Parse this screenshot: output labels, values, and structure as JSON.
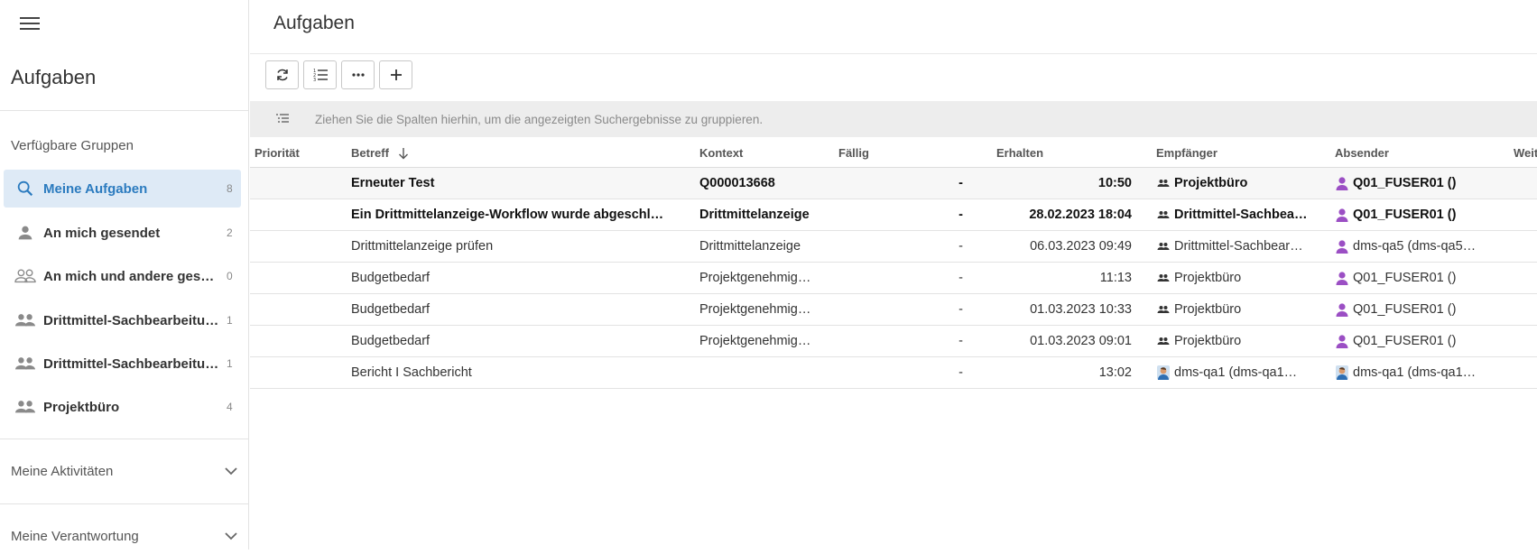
{
  "sidebar": {
    "title": "Aufgaben",
    "groups_heading": "Verfügbare Gruppen",
    "items": [
      {
        "label": "Meine Aufgaben",
        "count": "8",
        "icon": "search-icon"
      },
      {
        "label": "An mich gesendet",
        "count": "2",
        "icon": "person-icon"
      },
      {
        "label": "An mich und andere gese…",
        "count": "0",
        "icon": "people-outline-icon"
      },
      {
        "label": "Drittmittel-Sachbearbeitu…",
        "count": "1",
        "icon": "group-icon"
      },
      {
        "label": "Drittmittel-Sachbearbeitu…",
        "count": "1",
        "icon": "group-icon"
      },
      {
        "label": "Projektbüro",
        "count": "4",
        "icon": "group-icon"
      }
    ],
    "sections": [
      {
        "label": "Meine Aktivitäten"
      },
      {
        "label": "Meine Verantwortung"
      }
    ]
  },
  "main": {
    "title": "Aufgaben",
    "group_hint": "Ziehen Sie die Spalten hierhin, um die angezeigten Suchergebnisse zu gruppieren."
  },
  "table": {
    "columns": {
      "prioritaet": "Priorität",
      "betreff": "Betreff",
      "kontext": "Kontext",
      "faellig": "Fällig",
      "erhalten": "Erhalten",
      "empfaenger": "Empfänger",
      "absender": "Absender",
      "weitere": "Weit"
    },
    "rows": [
      {
        "betreff": "Erneuter Test",
        "kontext": "Q000013668",
        "faellig": "-",
        "erhalten": "10:50",
        "empfaenger": "Projektbüro",
        "absender": "Q01_FUSER01 ()",
        "bold": true
      },
      {
        "betreff": "Ein Drittmittelanzeige-Workflow wurde abgeschlo…",
        "kontext": "Drittmittelanzeige",
        "faellig": "-",
        "erhalten": "28.02.2023 18:04",
        "empfaenger": "Drittmittel-Sachbea…",
        "absender": "Q01_FUSER01 ()",
        "bold": true
      },
      {
        "betreff": "Drittmittelanzeige prüfen",
        "kontext": "Drittmittelanzeige",
        "faellig": "-",
        "erhalten": "06.03.2023 09:49",
        "empfaenger": "Drittmittel-Sachbear…",
        "absender": "dms-qa5 (dms-qa5…",
        "bold": false
      },
      {
        "betreff": "Budgetbedarf",
        "kontext": "Projektgenehmig…",
        "faellig": "-",
        "erhalten": "11:13",
        "empfaenger": "Projektbüro",
        "absender": "Q01_FUSER01 ()",
        "bold": false
      },
      {
        "betreff": "Budgetbedarf",
        "kontext": "Projektgenehmig…",
        "faellig": "-",
        "erhalten": "01.03.2023 10:33",
        "empfaenger": "Projektbüro",
        "absender": "Q01_FUSER01 ()",
        "bold": false
      },
      {
        "betreff": "Budgetbedarf",
        "kontext": "Projektgenehmig…",
        "faellig": "-",
        "erhalten": "01.03.2023 09:01",
        "empfaenger": "Projektbüro",
        "absender": "Q01_FUSER01 ()",
        "bold": false
      },
      {
        "betreff": "Bericht I Sachbericht",
        "kontext": "",
        "faellig": "-",
        "erhalten": "13:02",
        "empfaenger": "dms-qa1 (dms-qa1…",
        "absender": "dms-qa1 (dms-qa1…",
        "bold": false
      }
    ]
  },
  "colors": {
    "accent": "#2b7bbf",
    "active_bg": "#deeaf6",
    "user_icon": "#9b4fc4",
    "group_bar": "#ededed"
  }
}
